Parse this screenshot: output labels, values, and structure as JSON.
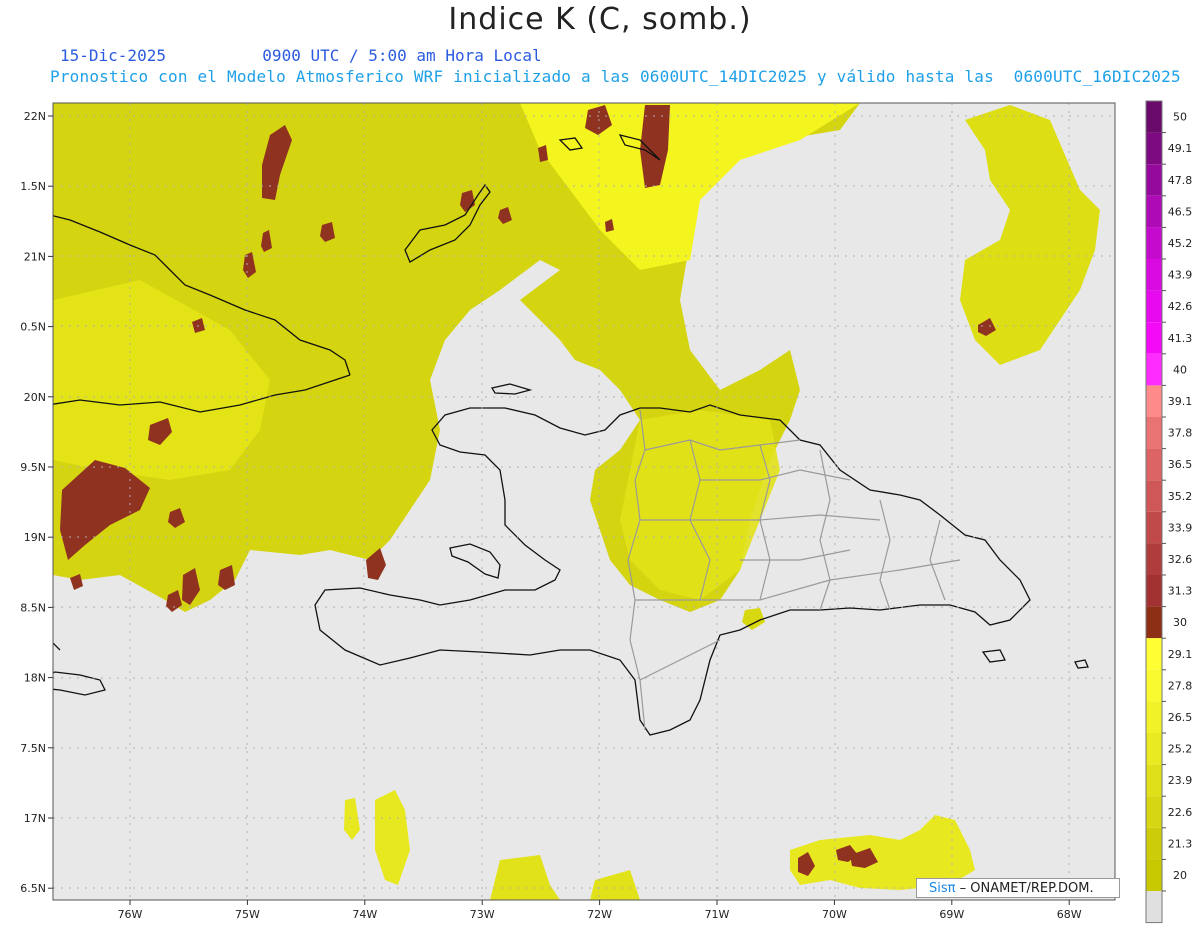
{
  "header": {
    "title": "Indice K (C, somb.)",
    "date": "15-Dic-2025",
    "time": "0900 UTC / 5:00 am Hora Local",
    "description": "Pronostico con el Modelo Atmosferico WRF inicializado a las 0600UTC_14DIC2025 y válido hasta las  0600UTC_16DIC2025"
  },
  "map": {
    "lat_labels": [
      "22N",
      "1.5N",
      "21N",
      "0.5N",
      "20N",
      "9.5N",
      "19N",
      "8.5N",
      "18N",
      "7.5N",
      "17N",
      "6.5N"
    ],
    "lon_labels": [
      "76W",
      "75W",
      "74W",
      "73W",
      "72W",
      "71W",
      "70W",
      "69W",
      "68W"
    ],
    "colors": {
      "background": "#e8e8e8",
      "k_low": "#d2d200",
      "k_mid": "#e8e820",
      "k_high": "#ffff33",
      "k_storm": "#8b2e1c",
      "coast": "#111111",
      "borders": "#a0a0a0"
    }
  },
  "colorbar": {
    "levels": [
      "50",
      "49.1",
      "47.8",
      "46.5",
      "45.2",
      "43.9",
      "42.6",
      "41.3",
      "40",
      "39.1",
      "37.8",
      "36.5",
      "35.2",
      "33.9",
      "32.6",
      "31.3",
      "30",
      "29.1",
      "27.8",
      "26.5",
      "25.2",
      "23.9",
      "22.6",
      "21.3",
      "20"
    ],
    "colors": [
      "#6a0a6a",
      "#7d0a80",
      "#950a9c",
      "#ae0ab5",
      "#c40acc",
      "#d80ae0",
      "#e80aee",
      "#f50af8",
      "#ff2cff",
      "#ff8a8a",
      "#e97272",
      "#dc6464",
      "#cf5757",
      "#c04a4a",
      "#b03d3d",
      "#a23232",
      "#8c2f14",
      "#ffff33",
      "#fafa30",
      "#f2f228",
      "#eaea22",
      "#e0e01a",
      "#d6d612",
      "#cccc08",
      "#c8c800",
      "#e0e0e0"
    ]
  },
  "credit": {
    "sis": "Sisπ",
    "rest": "– ONAMET/REP.DOM."
  }
}
